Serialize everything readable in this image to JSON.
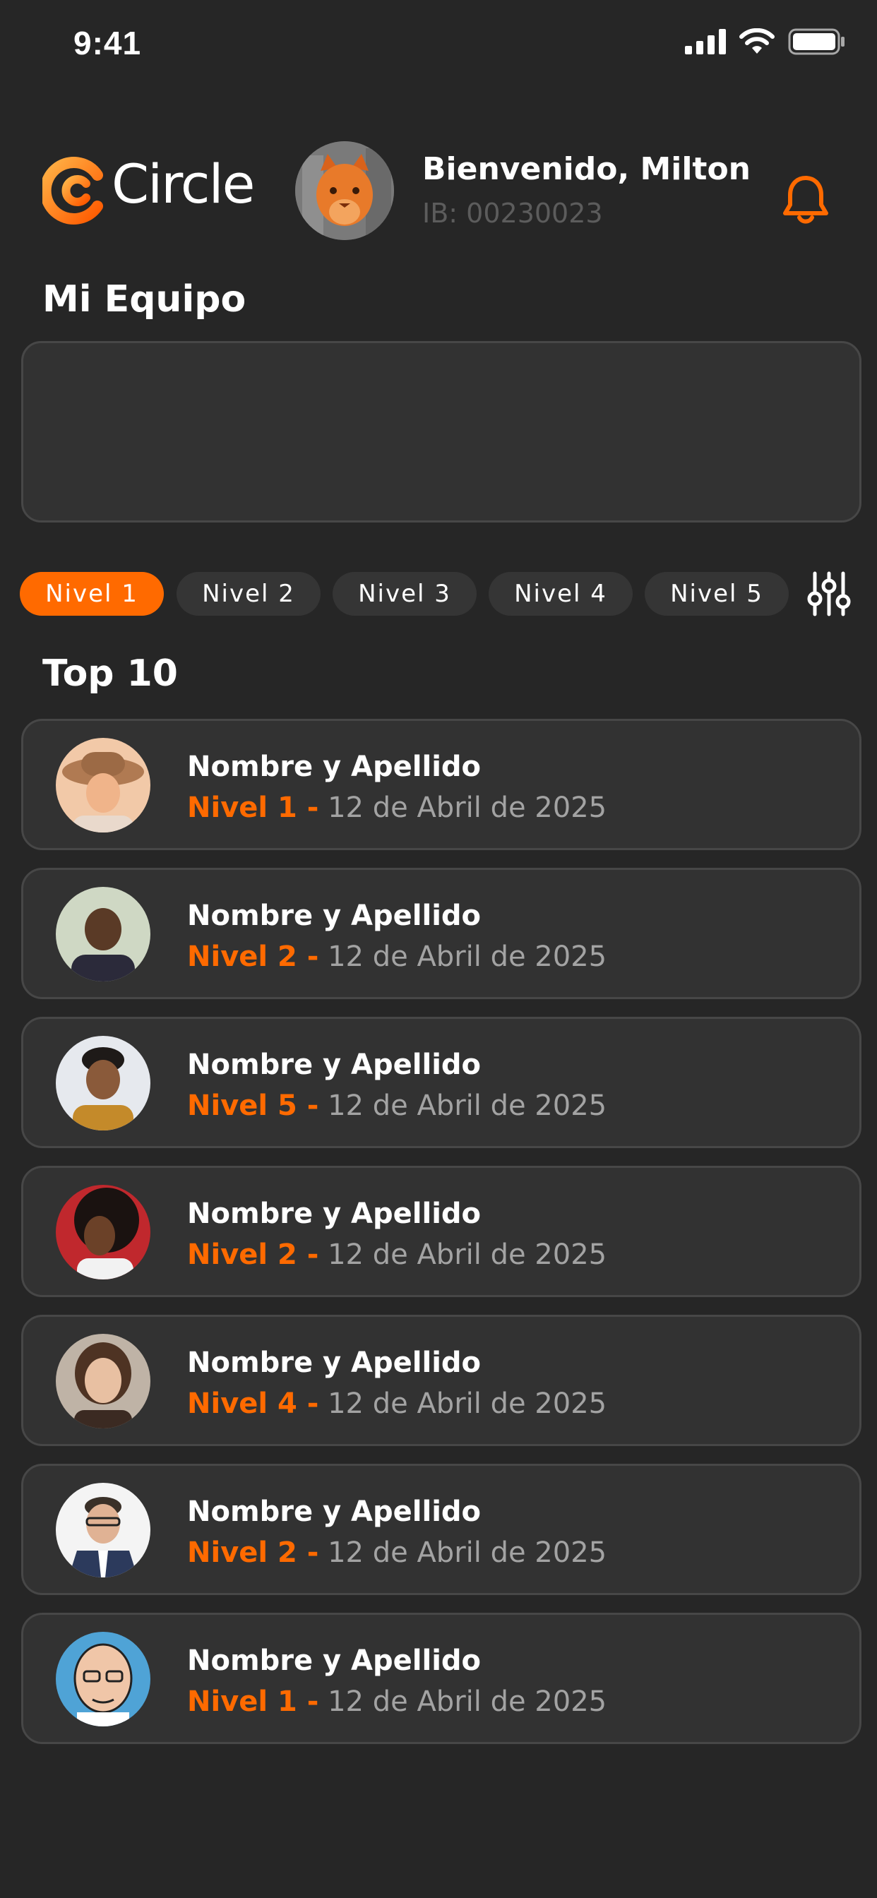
{
  "status": {
    "time": "9:41"
  },
  "header": {
    "logo_text": "Circle",
    "welcome": "Bienvenido, Milton",
    "ib": "IB: 00230023"
  },
  "team": {
    "title": "Mi Equipo"
  },
  "tabs": [
    {
      "label": "Nivel 1",
      "active": true
    },
    {
      "label": "Nivel 2",
      "active": false
    },
    {
      "label": "Nivel 3",
      "active": false
    },
    {
      "label": "Nivel 4",
      "active": false
    },
    {
      "label": "Nivel 5",
      "active": false
    }
  ],
  "top": {
    "title": "Top 10",
    "items": [
      {
        "name": "Nombre y Apellido",
        "level": "Nivel 1 -",
        "date": "12 de Abril de 2025"
      },
      {
        "name": "Nombre y Apellido",
        "level": "Nivel 2 -",
        "date": "12 de Abril de 2025"
      },
      {
        "name": "Nombre y Apellido",
        "level": "Nivel 5 -",
        "date": "12 de Abril de 2025"
      },
      {
        "name": "Nombre y Apellido",
        "level": "Nivel 2 -",
        "date": "12 de Abril de 2025"
      },
      {
        "name": "Nombre y Apellido",
        "level": "Nivel 4 -",
        "date": "12 de Abril de 2025"
      },
      {
        "name": "Nombre y Apellido",
        "level": "Nivel 2 -",
        "date": "12 de Abril de 2025"
      },
      {
        "name": "Nombre y Apellido",
        "level": "Nivel 1 -",
        "date": "12 de Abril de 2025"
      }
    ]
  },
  "colors": {
    "accent": "#ff6a00",
    "background": "#262626",
    "card": "#323232",
    "border": "#474747"
  },
  "icons": [
    "signal-icon",
    "wifi-icon",
    "battery-icon",
    "bell-icon",
    "filter-sliders-icon",
    "circle-logo-icon"
  ]
}
